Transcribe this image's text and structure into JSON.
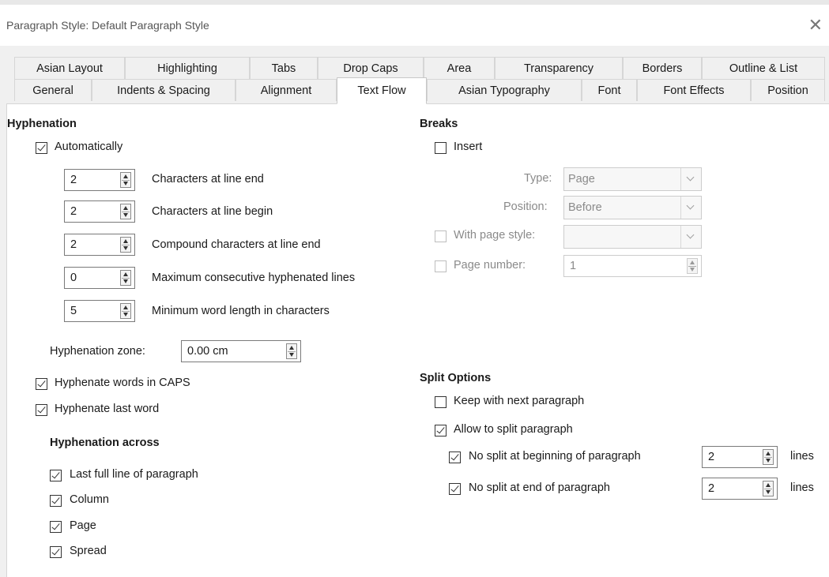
{
  "window": {
    "title": "Paragraph Style: Default Paragraph Style"
  },
  "tabs": {
    "row1": [
      "Asian Layout",
      "Highlighting",
      "Tabs",
      "Drop Caps",
      "Area",
      "Transparency",
      "Borders",
      "Outline & List"
    ],
    "row2": [
      "General",
      "Indents & Spacing",
      "Alignment",
      "Text Flow",
      "Asian Typography",
      "Font",
      "Font Effects",
      "Position"
    ],
    "active": "Text Flow"
  },
  "hyphenation": {
    "heading": "Hyphenation",
    "automatically": {
      "label": "Automatically",
      "checked": true
    },
    "chars_line_end": {
      "value": "2",
      "label": "Characters at line end"
    },
    "chars_line_begin": {
      "value": "2",
      "label": "Characters at line begin"
    },
    "compound_chars": {
      "value": "2",
      "label": "Compound characters at line end"
    },
    "max_consecutive": {
      "value": "0",
      "label": "Maximum consecutive hyphenated lines"
    },
    "min_word_length": {
      "value": "5",
      "label": "Minimum word length in characters"
    },
    "zone": {
      "label": "Hyphenation zone:",
      "value": "0.00 cm"
    },
    "words_in_caps": {
      "label": "Hyphenate words in CAPS",
      "checked": true
    },
    "last_word": {
      "label": "Hyphenate last word",
      "checked": true
    },
    "across_heading": "Hyphenation across",
    "across": [
      {
        "label": "Last full line of paragraph",
        "checked": true
      },
      {
        "label": "Column",
        "checked": true
      },
      {
        "label": "Page",
        "checked": true
      },
      {
        "label": "Spread",
        "checked": true
      }
    ]
  },
  "breaks": {
    "heading": "Breaks",
    "insert": {
      "label": "Insert",
      "checked": false
    },
    "type": {
      "label": "Type:",
      "value": "Page"
    },
    "position": {
      "label": "Position:",
      "value": "Before"
    },
    "with_page_style": {
      "label": "With page style:",
      "checked": false,
      "value": ""
    },
    "page_number": {
      "label": "Page number:",
      "checked": false,
      "value": "1"
    }
  },
  "split_options": {
    "heading": "Split Options",
    "keep_with_next": {
      "label": "Keep with next paragraph",
      "checked": false
    },
    "allow_split": {
      "label": "Allow to split paragraph",
      "checked": true
    },
    "no_split_begin": {
      "label": "No split at beginning of paragraph",
      "checked": true,
      "value": "2",
      "unit": "lines"
    },
    "no_split_end": {
      "label": "No split at end of paragraph",
      "checked": true,
      "value": "2",
      "unit": "lines"
    }
  }
}
